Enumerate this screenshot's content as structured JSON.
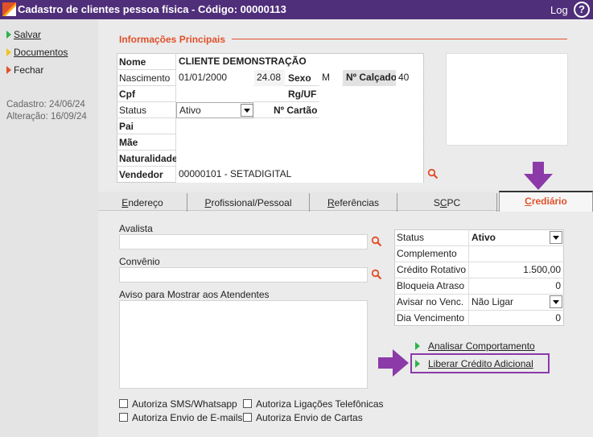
{
  "window": {
    "title": "Cadastro de clientes pessoa física - Código: 00000113",
    "log_label": "Log",
    "help_glyph": "?"
  },
  "sidebar": {
    "actions": [
      {
        "label": "Salvar",
        "color": "#2db34a"
      },
      {
        "label": "Documentos",
        "color": "#f0c419"
      },
      {
        "label": "Fechar",
        "color": "#e0502a"
      }
    ],
    "cadastro": "Cadastro: 24/06/24",
    "alteracao": "Alteração: 16/09/24"
  },
  "section": {
    "title": "Informações Principais",
    "accent": "#e0502a"
  },
  "form": {
    "nome_label": "Nome",
    "nome_value": "CLIENTE DEMONSTRAÇÃO",
    "nascimento_label": "Nascimento",
    "nascimento_value": "01/01/2000",
    "idade_value": "24.08",
    "sexo_label": "Sexo",
    "sexo_value": "M",
    "calcado_label": "Nº Calçado",
    "calcado_value": "40",
    "cpf_label": "Cpf",
    "cpf_value": "",
    "rguf_label": "Rg/UF",
    "rguf_value": "",
    "status_label": "Status",
    "status_value": "Ativo",
    "cartao_label": "Nº Cartão",
    "cartao_value": "",
    "pai_label": "Pai",
    "pai_value": "",
    "mae_label": "Mãe",
    "mae_value": "",
    "naturalidade_label": "Naturalidade",
    "naturalidade_value": "",
    "vendedor_label": "Vendedor",
    "vendedor_value": "00000101 - SETADIGITAL"
  },
  "tabs": [
    {
      "pre": "",
      "acc": "E",
      "post": "ndereço",
      "active": false
    },
    {
      "pre": "",
      "acc": "P",
      "post": "rofissional/Pessoal",
      "active": false
    },
    {
      "pre": "",
      "acc": "R",
      "post": "eferências",
      "active": false
    },
    {
      "pre": "S",
      "acc": "C",
      "post": "PC",
      "active": false
    },
    {
      "pre": "",
      "acc": "C",
      "post": "rediário",
      "active": true
    }
  ],
  "crediario": {
    "avalista_label": "Avalista",
    "avalista_value": "",
    "convenio_label": "Convênio",
    "convenio_value": "",
    "aviso_label": "Aviso para Mostrar aos Atendentes",
    "aviso_value": "",
    "status_label": "Status",
    "status_value": "Ativo",
    "complemento_label": "Complemento",
    "complemento_value": "",
    "credito_label": "Crédito Rotativo",
    "credito_value": "1.500,00",
    "bloqueia_label": "Bloqueia Atraso",
    "bloqueia_value": "0",
    "avisar_label": "Avisar no Venc.",
    "avisar_value": "Não Ligar",
    "dia_label": "Dia Vencimento",
    "dia_value": "0",
    "analisar_label": "Analisar Comportamento",
    "liberar_label": "Liberar Crédito Adicional",
    "checkboxes": [
      {
        "label": "Autoriza SMS/Whatsapp",
        "checked": false
      },
      {
        "label": "Autoriza Ligações Telefônicas",
        "checked": false
      },
      {
        "label": "Autoriza Envio de E-mails",
        "checked": false
      },
      {
        "label": "Autoriza Envio de Cartas",
        "checked": false
      }
    ]
  },
  "colors": {
    "titlebar": "#4f2e7a",
    "highlight": "#8b3aa8",
    "action_green": "#2db34a"
  }
}
